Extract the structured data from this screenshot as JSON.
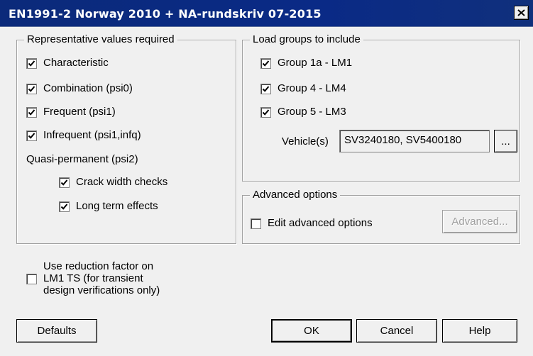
{
  "window": {
    "title": "EN1991-2 Norway 2010 + NA-rundskriv 07-2015",
    "close_glyph": "close-icon"
  },
  "rep_values": {
    "legend": "Representative values required",
    "characteristic": "Characteristic",
    "combination": "Combination (psi0)",
    "frequent": "Frequent (psi1)",
    "infrequent": "Infrequent (psi1,infq)",
    "quasi_label": "Quasi-permanent (psi2)",
    "crack": "Crack width checks",
    "long_term": "Long term effects"
  },
  "load_groups": {
    "legend": "Load groups to include",
    "group1a": "Group 1a - LM1",
    "group4": "Group 4 - LM4",
    "group5": "Group 5 - LM3",
    "vehicles_label": "Vehicle(s)",
    "vehicles_value": "SV3240180, SV5400180",
    "browse_label": "..."
  },
  "advanced": {
    "legend": "Advanced options",
    "edit_label": "Edit advanced options",
    "button_label": "Advanced..."
  },
  "reduction": {
    "line1": "Use reduction factor on",
    "line2": "LM1 TS (for transient",
    "line3": "design verifications only)"
  },
  "buttons": {
    "defaults": "Defaults",
    "ok": "OK",
    "cancel": "Cancel",
    "help": "Help"
  },
  "colors": {
    "titlebar": "#0a2a86",
    "face": "#f0f0f0"
  }
}
